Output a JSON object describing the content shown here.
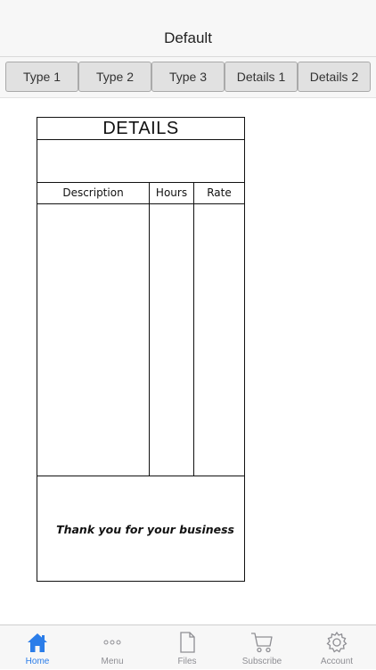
{
  "nav": {
    "title": "Default"
  },
  "segments": [
    "Type 1",
    "Type 2",
    "Type 3",
    "Details 1",
    "Details 2"
  ],
  "document": {
    "title": "DETAILS",
    "columns": [
      "Description",
      "Hours",
      "Rate"
    ],
    "footer_note": "Thank you for your business"
  },
  "tabs": [
    {
      "label": "Home",
      "icon": "home-icon",
      "active": true
    },
    {
      "label": "Menu",
      "icon": "more-icon",
      "active": false
    },
    {
      "label": "Files",
      "icon": "file-icon",
      "active": false
    },
    {
      "label": "Subscribe",
      "icon": "cart-icon",
      "active": false
    },
    {
      "label": "Account",
      "icon": "gear-icon",
      "active": false
    }
  ],
  "colors": {
    "accent": "#2b7de9",
    "inactive": "#8e8e93"
  }
}
